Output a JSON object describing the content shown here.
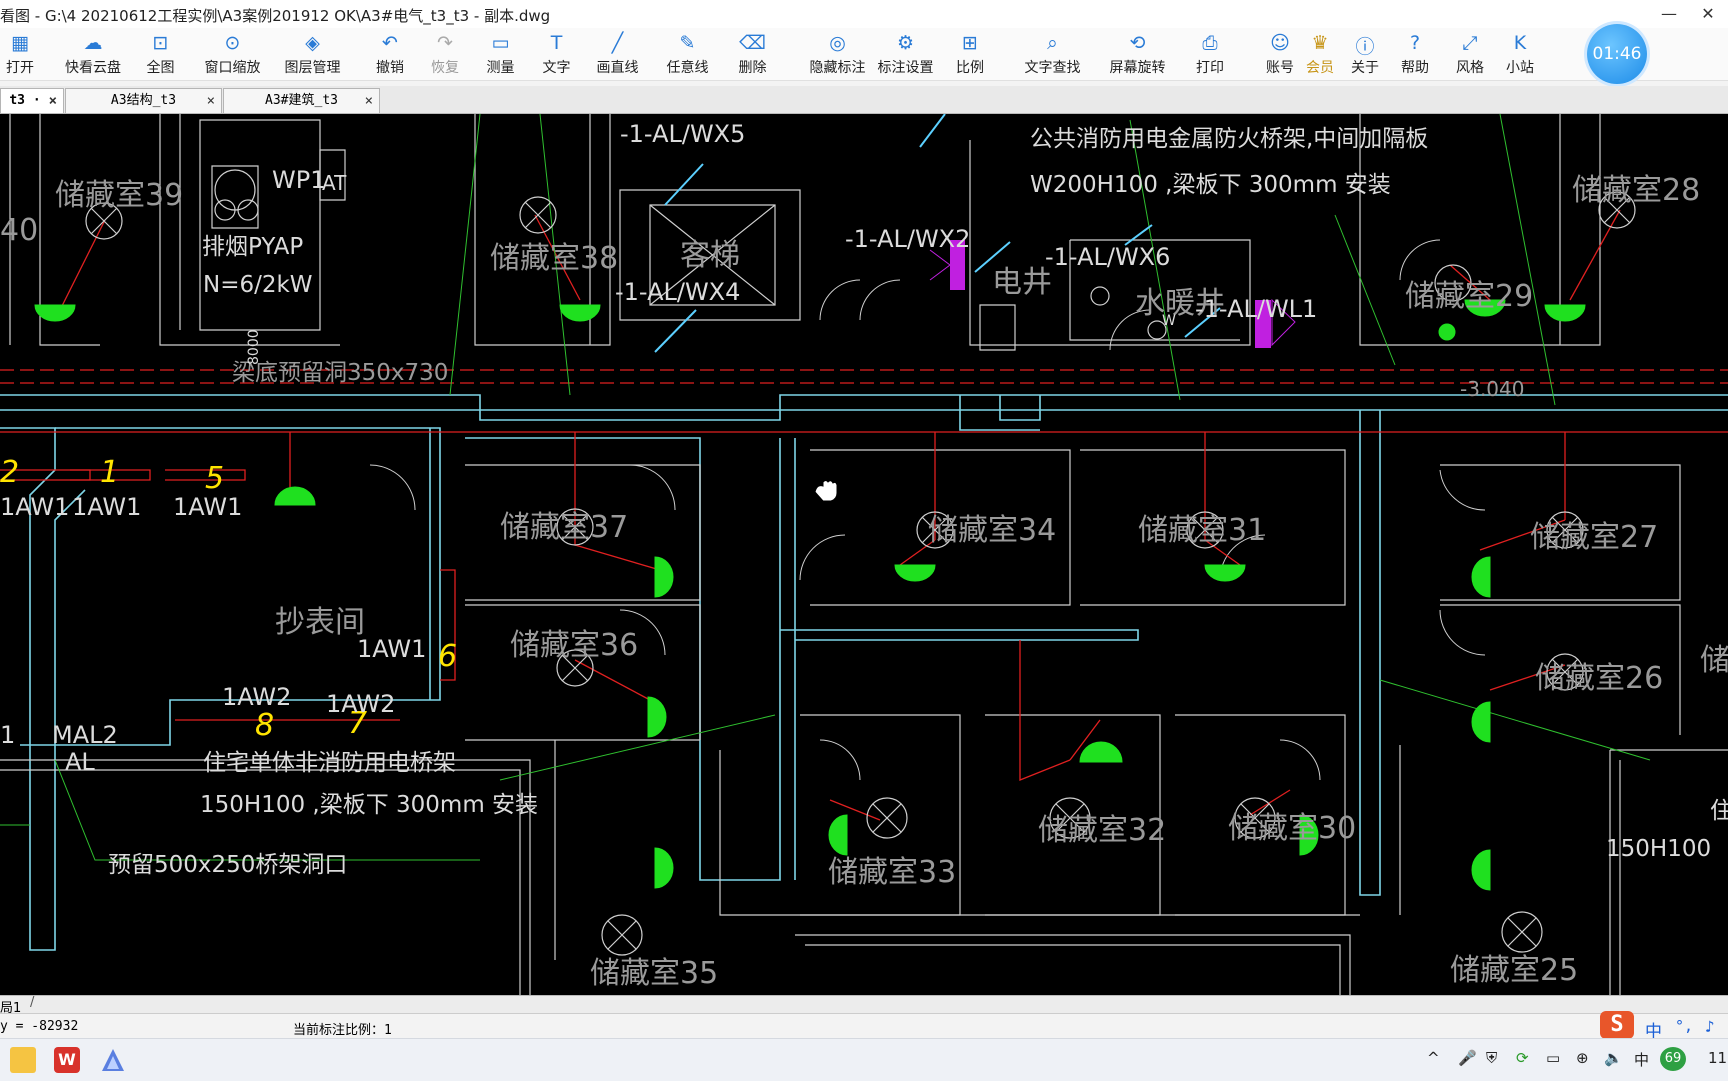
{
  "window": {
    "title": "看图 - G:\\4 20210612工程实例\\A3案例201912 OK\\A3#电气_t3_t3 - 副本.dwg",
    "minimize": "—",
    "close": "✕"
  },
  "toolbar": [
    {
      "label": "打开",
      "icon": "folder-open-icon"
    },
    {
      "label": "快看云盘",
      "icon": "cloud-icon"
    },
    {
      "label": "全图",
      "icon": "fit-all-icon"
    },
    {
      "label": "窗口缩放",
      "icon": "window-zoom-icon"
    },
    {
      "label": "图层管理",
      "icon": "layers-icon"
    },
    {
      "label": "撤销",
      "icon": "undo-icon"
    },
    {
      "label": "恢复",
      "icon": "redo-icon"
    },
    {
      "label": "测量",
      "icon": "ruler-icon"
    },
    {
      "label": "文字",
      "icon": "text-icon"
    },
    {
      "label": "画直线",
      "icon": "line-icon"
    },
    {
      "label": "任意线",
      "icon": "pen-icon"
    },
    {
      "label": "删除",
      "icon": "eraser-icon"
    },
    {
      "label": "隐藏标注",
      "icon": "eye-hide-icon"
    },
    {
      "label": "标注设置",
      "icon": "annotation-settings-icon"
    },
    {
      "label": "比例",
      "icon": "scale-icon"
    },
    {
      "label": "文字查找",
      "icon": "text-search-icon"
    },
    {
      "label": "屏幕旋转",
      "icon": "rotate-screen-icon"
    },
    {
      "label": "打印",
      "icon": "printer-icon"
    },
    {
      "label": "账号",
      "icon": "user-icon"
    },
    {
      "label": "会员",
      "icon": "vip-icon"
    },
    {
      "label": "关于",
      "icon": "info-icon"
    },
    {
      "label": "帮助",
      "icon": "help-icon"
    },
    {
      "label": "风格",
      "icon": "style-icon"
    },
    {
      "label": "小站",
      "icon": "k-site-icon"
    }
  ],
  "clock": "01:46",
  "tabs": [
    {
      "label": "t3 ·",
      "active": true
    },
    {
      "label": "A3结构_t3",
      "active": false
    },
    {
      "label": "A3#建筑_t3",
      "active": false
    }
  ],
  "tab_close": "×",
  "drawing": {
    "rooms": [
      "储藏室39",
      "储藏室38",
      "储藏室28",
      "储藏室29",
      "储藏室37",
      "储藏室34",
      "储藏室31",
      "储藏室27",
      "储藏室36",
      "储藏室26",
      "储藏室33",
      "储藏室32",
      "储藏室30",
      "储藏室35",
      "储藏室25",
      "抄表间",
      "客梯",
      "电井",
      "水暖井",
      "40",
      "储"
    ],
    "circuits": [
      "-1-AL/WX5",
      "-1-AL/WX4",
      "-1-AL/WX2",
      "-1-AL/WX6",
      "-1-AL/WL1",
      "1AW1",
      "1AW1",
      "1AW1",
      "1AW1",
      "1AW2",
      "1AW2",
      "MAL2",
      "AL",
      "1",
      "WP1",
      "AT"
    ],
    "notes": [
      "公共消防用电金属防火桥架,中间加隔板",
      "W200H100    ,梁板下   300mm    安装",
      "排烟PYAP",
      "N=6/2kW",
      "梁底预留洞350x730",
      "-3.040",
      "住宅单体非消防用电桥架",
      "150H100    ,梁板下   300mm    安装",
      "预留500x250桥架洞口",
      "150H100",
      "住",
      "W",
      "8000"
    ],
    "handwritten": [
      "2",
      "1",
      "5",
      "6",
      "8",
      "7"
    ]
  },
  "layout_tab": "局1",
  "status": {
    "coords": "y = -82932",
    "scale": "当前标注比例：1"
  },
  "tray": {
    "ime_cn": "中",
    "ime_punct": "°,",
    "lang": "中",
    "badge": "69",
    "time": "11"
  },
  "colors": {
    "canvas": "#000000",
    "wall": "#7fd6e8",
    "wire": "#e02020",
    "lamp": "#1fe01f",
    "text": "#dcdcdc",
    "yellow": "#ffe400",
    "magenta": "#c020e0",
    "accent": "#1c8be8"
  }
}
